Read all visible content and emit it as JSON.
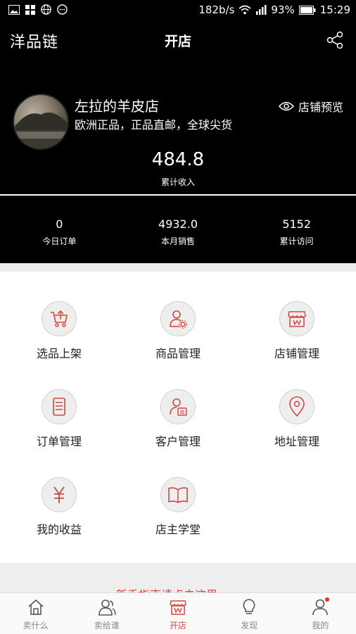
{
  "status_bar": {
    "net_speed": "182b/s",
    "battery": "93%",
    "time": "15:29"
  },
  "header": {
    "logo": "洋品链",
    "title": "开店"
  },
  "profile": {
    "shop_name": "左拉的羊皮店",
    "shop_desc": "欧洲正品，正品直邮，全球尖货",
    "preview_label": "店铺预览",
    "income_value": "484.8",
    "income_label": "累计收入"
  },
  "stats": [
    {
      "value": "0",
      "label": "今日订单"
    },
    {
      "value": "4932.0",
      "label": "本月销售"
    },
    {
      "value": "5152",
      "label": "累计访问"
    }
  ],
  "menu": [
    {
      "label": "选品上架",
      "icon": "cart-upload-icon"
    },
    {
      "label": "商品管理",
      "icon": "user-gear-icon"
    },
    {
      "label": "店铺管理",
      "icon": "store-icon"
    },
    {
      "label": "订单管理",
      "icon": "document-icon"
    },
    {
      "label": "客户管理",
      "icon": "customer-card-icon"
    },
    {
      "label": "地址管理",
      "icon": "location-pin-icon"
    },
    {
      "label": "我的收益",
      "icon": "yen-icon"
    },
    {
      "label": "店主学堂",
      "icon": "book-icon"
    }
  ],
  "guide_text": "新手指南请点击这里 >>",
  "tabs": [
    {
      "label": "卖什么",
      "icon": "home-icon"
    },
    {
      "label": "卖给谁",
      "icon": "users-icon"
    },
    {
      "label": "开店",
      "icon": "store-icon",
      "active": true
    },
    {
      "label": "发现",
      "icon": "bulb-icon"
    },
    {
      "label": "我的",
      "icon": "profile-icon"
    }
  ],
  "colors": {
    "accent": "#d6453c",
    "header_bg": "#000000",
    "icon_bg": "#eeeeee"
  }
}
